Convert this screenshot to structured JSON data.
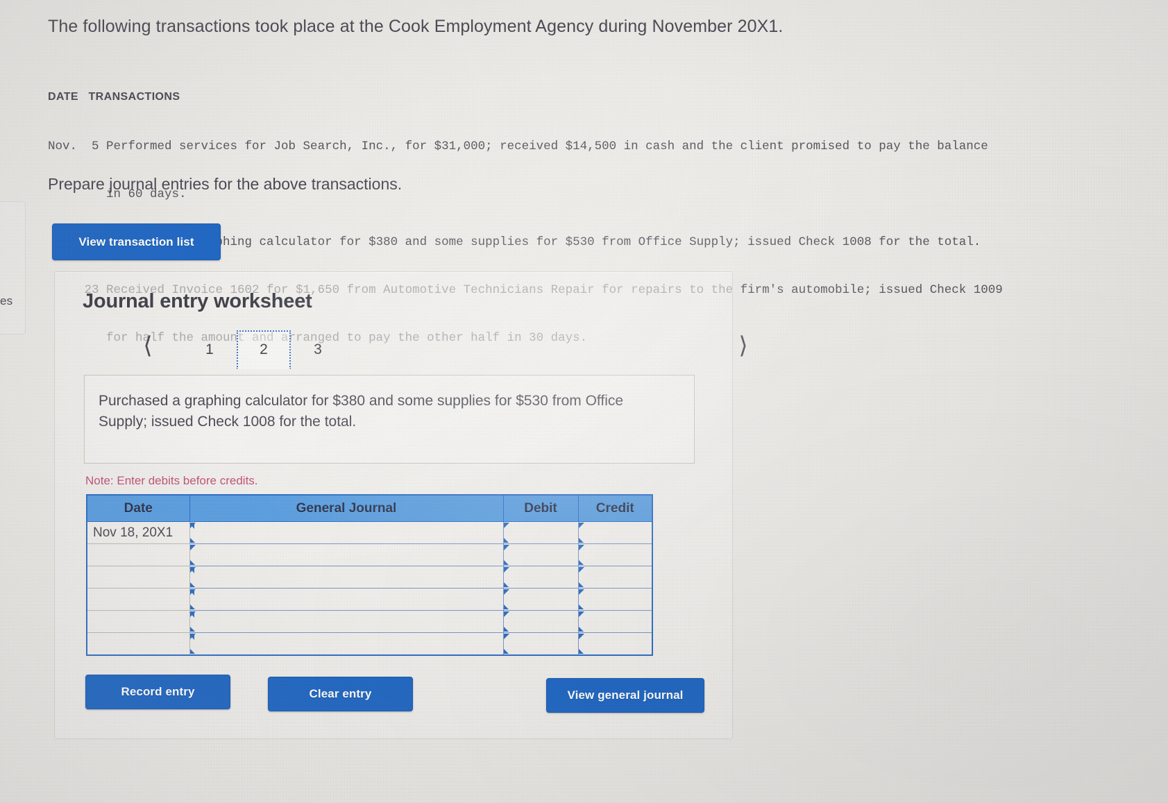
{
  "left_sliver": {
    "fragment_text": "es"
  },
  "intro": "The following transactions took place at the Cook Employment Agency during November 20X1.",
  "transactions": {
    "header": "DATE   TRANSACTIONS",
    "lines": [
      "Nov.  5 Performed services for Job Search, Inc., for $31,000; received $14,500 in cash and the client promised to pay the balance",
      "        in 60 days.",
      "     18 Purchased a graphing calculator for $380 and some supplies for $530 from Office Supply; issued Check 1008 for the total.",
      "     23 Received Invoice 1602 for $1,650 from Automotive Technicians Repair for repairs to the firm's automobile; issued Check 1009",
      "        for half the amount and arranged to pay the other half in 30 days."
    ]
  },
  "prepare_instruction": "Prepare journal entries for the above transactions.",
  "view_transaction_list_label": "View transaction list",
  "worksheet": {
    "title": "Journal entry worksheet",
    "pager": {
      "prev_icon": "chevron-left-icon",
      "next_icon": "chevron-right-icon",
      "tabs": [
        {
          "label": "1",
          "active": false
        },
        {
          "label": "2",
          "active": true
        },
        {
          "label": "3",
          "active": false
        }
      ],
      "active_tab": "2"
    },
    "description": "Purchased a graphing calculator for $380 and some supplies for $530 from Office Supply; issued Check 1008 for the total.",
    "note": "Note: Enter debits before credits.",
    "table": {
      "columns": [
        "Date",
        "General Journal",
        "Debit",
        "Credit"
      ],
      "rows": [
        {
          "date": "Nov 18, 20X1",
          "general_journal": "",
          "debit": "",
          "credit": ""
        },
        {
          "date": "",
          "general_journal": "",
          "debit": "",
          "credit": ""
        },
        {
          "date": "",
          "general_journal": "",
          "debit": "",
          "credit": ""
        },
        {
          "date": "",
          "general_journal": "",
          "debit": "",
          "credit": ""
        },
        {
          "date": "",
          "general_journal": "",
          "debit": "",
          "credit": ""
        },
        {
          "date": "",
          "general_journal": "",
          "debit": "",
          "credit": ""
        }
      ]
    },
    "buttons": {
      "record": "Record entry",
      "clear": "Clear entry",
      "view_general_journal": "View general journal"
    }
  },
  "colors": {
    "button_blue": "#2168c4",
    "table_header_blue": "#5d9fe0",
    "table_border_blue": "#2f6fc4",
    "note_red": "#c2557a",
    "page_background": "#eceae6"
  }
}
